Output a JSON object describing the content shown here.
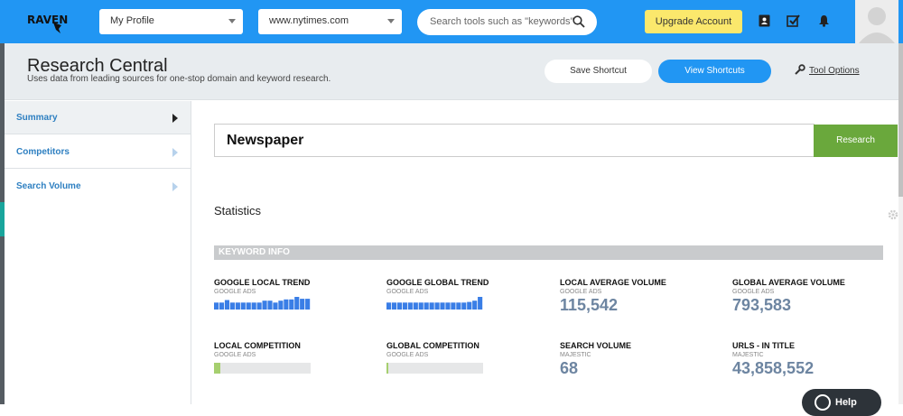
{
  "topbar": {
    "logo_text": "RAVEN",
    "profile_select": "My Profile",
    "domain_select": "www.nytimes.com",
    "search_placeholder": "Search tools such as \"keywords\"",
    "upgrade_label": "Upgrade Account",
    "icons": [
      "contacts-icon",
      "tasks-icon",
      "notifications-icon"
    ],
    "accent_color": "#2196f3"
  },
  "header": {
    "title": "Research Central",
    "subtitle": "Uses data from leading sources for one-stop domain and keyword research.",
    "save_shortcut_label": "Save Shortcut",
    "view_shortcuts_label": "View Shortcuts",
    "tool_options_label": "Tool Options"
  },
  "sidebar": {
    "items": [
      {
        "label": "Summary",
        "active": true
      },
      {
        "label": "Competitors",
        "active": false
      },
      {
        "label": "Search Volume",
        "active": false
      }
    ]
  },
  "research": {
    "keyword_value": "Newspaper",
    "research_button_label": "Research",
    "button_color": "#6aa83c"
  },
  "stats": {
    "title": "Statistics",
    "section_label": "KEYWORD INFO",
    "google_local_trend": {
      "name": "GOOGLE LOCAL TREND",
      "source": "GOOGLE ADS",
      "levels": [
        0.55,
        0.55,
        0.75,
        0.55,
        0.55,
        0.55,
        0.55,
        0.55,
        0.55,
        0.7,
        0.7,
        0.55,
        0.7,
        0.8,
        0.8,
        1.0,
        0.85,
        0.85
      ]
    },
    "google_global_trend": {
      "name": "GOOGLE GLOBAL TREND",
      "source": "GOOGLE ADS",
      "levels": [
        0.55,
        0.55,
        0.55,
        0.55,
        0.55,
        0.55,
        0.55,
        0.55,
        0.55,
        0.55,
        0.55,
        0.55,
        0.55,
        0.55,
        0.55,
        0.6,
        0.7,
        1.0
      ]
    },
    "local_average_volume": {
      "name": "LOCAL AVERAGE VOLUME",
      "source": "GOOGLE ADS",
      "value": "115,542"
    },
    "global_average_volume": {
      "name": "GLOBAL AVERAGE VOLUME",
      "source": "GOOGLE ADS",
      "value": "793,583"
    },
    "local_competition": {
      "name": "LOCAL COMPETITION",
      "source": "GOOGLE ADS",
      "level": 0.07
    },
    "global_competition": {
      "name": "GLOBAL COMPETITION",
      "source": "GOOGLE ADS",
      "level": 0.02
    },
    "search_volume": {
      "name": "SEARCH VOLUME",
      "source": "MAJESTIC",
      "value": "68"
    },
    "urls_in_title": {
      "name": "URLS - IN TITLE",
      "source": "MAJESTIC",
      "value": "43,858,552"
    },
    "value_color": "#6d85a1",
    "trend_color": "#3a7ee6"
  },
  "help": {
    "label": "Help"
  }
}
